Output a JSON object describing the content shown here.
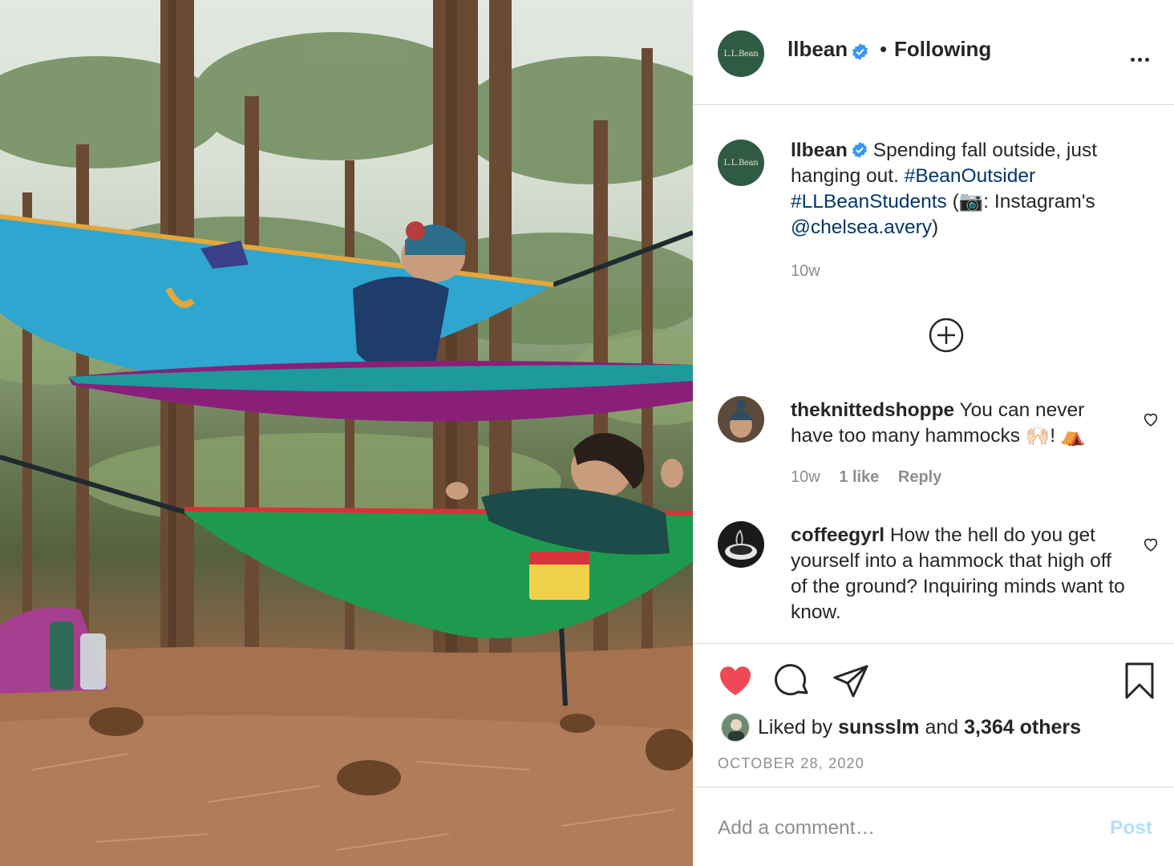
{
  "post": {
    "username": "llbean",
    "avatar_text": "L.L.Bean",
    "separator": "•",
    "follow_status": "Following",
    "photo_alt": "",
    "icons": {
      "verified": "verified-badge-icon",
      "more": "more-options-icon"
    }
  },
  "caption": {
    "username": "llbean",
    "text_before": "Spending fall outside, just hanging out.",
    "hashtag1": "#BeanOutsider",
    "hashtag2": "#LLBeanStudents",
    "credit_open": "(📷: Instagram's",
    "mention": "@chelsea.avery",
    "credit_close": ")",
    "time": "10w"
  },
  "load_more_icon": "plus-circle-icon",
  "comments": [
    {
      "username": "theknittedshoppe",
      "text": "You can never have too many hammocks 🙌🏻! ⛺",
      "time": "10w",
      "likes": "1 like",
      "reply": "Reply"
    },
    {
      "username": "coffeegyrl",
      "text": "How the hell do you get yourself into a hammock that high off of the ground? Inquiring minds want to know."
    }
  ],
  "actions": {
    "liked": true,
    "like_color": "#ed4956",
    "icons": [
      "heart-icon",
      "comment-icon",
      "share-icon",
      "bookmark-icon"
    ]
  },
  "likes": {
    "prefix": "Liked by",
    "user": "sunsslm",
    "and": "and",
    "others": "3,364 others"
  },
  "date": "OCTOBER 28, 2020",
  "add_comment": {
    "placeholder": "Add a comment…",
    "post_label": "Post",
    "post_color": "#b2dffc"
  },
  "colors": {
    "hashtag": "#00376b",
    "muted": "#8e8e8e",
    "brand_green": "#2f5a44"
  }
}
